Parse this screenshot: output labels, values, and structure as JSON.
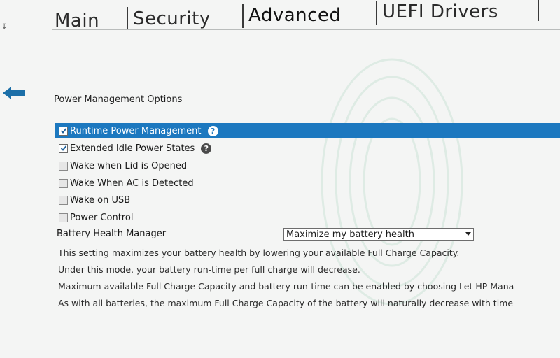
{
  "tabs": [
    {
      "label": "Main"
    },
    {
      "label": "Security"
    },
    {
      "label": "Advanced"
    },
    {
      "label": "UEFI Drivers"
    }
  ],
  "section": {
    "title": "Power Management Options"
  },
  "options": [
    {
      "label": "Runtime Power Management",
      "checked": true,
      "help": true,
      "selected": true
    },
    {
      "label": "Extended Idle Power States",
      "checked": true,
      "help": true,
      "selected": false
    },
    {
      "label": "Wake when Lid is Opened",
      "checked": false,
      "help": false,
      "selected": false
    },
    {
      "label": "Wake When AC is Detected",
      "checked": false,
      "help": false,
      "selected": false
    },
    {
      "label": "Wake on USB",
      "checked": false,
      "help": false,
      "selected": false
    },
    {
      "label": "Power Control",
      "checked": false,
      "help": false,
      "selected": false
    }
  ],
  "battery_health": {
    "label": "Battery Health Manager",
    "value": "Maximize my battery health"
  },
  "description": [
    "This setting maximizes your battery health by lowering your available Full Charge Capacity.",
    "Under this mode, your battery run-time per full charge will decrease.",
    "Maximum available Full Charge Capacity and battery run-time can be enabled by choosing Let HP Mana",
    "As with all batteries, the maximum Full Charge Capacity of the battery will naturally decrease with time"
  ],
  "help_glyph": "?",
  "colors": {
    "selected_row": "#1c78bf",
    "background": "#f4f5f4",
    "back_arrow": "#1c6fa8"
  },
  "icons": {
    "back": "left-arrow-icon",
    "help": "question-circle-icon",
    "check": "checkmark-icon"
  }
}
